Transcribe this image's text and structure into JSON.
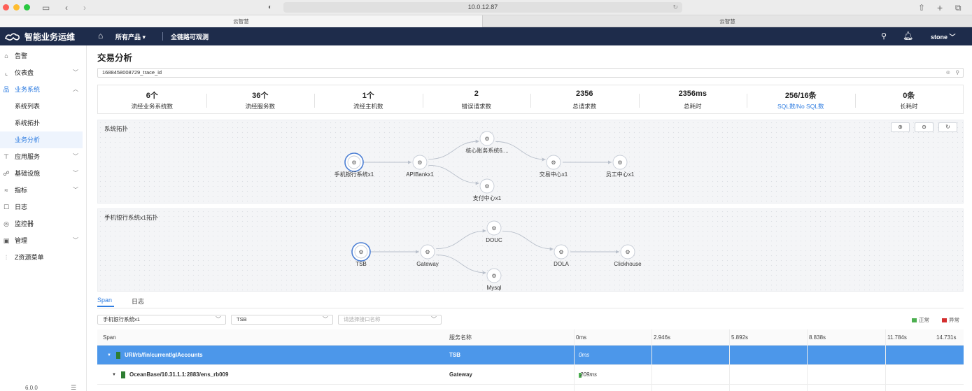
{
  "browser": {
    "url": "10.0.12.87",
    "tabs": [
      "云智慧",
      "云智慧"
    ]
  },
  "header": {
    "app_name": "智能业务运维",
    "products": "所有产品 ▾",
    "full_link": "全链路可观测",
    "user": "stone ﹀"
  },
  "sidebar": {
    "items": [
      {
        "icon": "alert-icon",
        "label": "告警"
      },
      {
        "icon": "dashboard-icon",
        "label": "仪表盘"
      },
      {
        "icon": "business-system-icon",
        "label": "业务系统"
      },
      {
        "label": "系统列表"
      },
      {
        "label": "系统拓扑"
      },
      {
        "label": "业务分析"
      },
      {
        "icon": "app-service-icon",
        "label": "应用服务"
      },
      {
        "icon": "infrastructure-icon",
        "label": "基础设施"
      },
      {
        "icon": "metrics-icon",
        "label": "指标"
      },
      {
        "icon": "log-icon",
        "label": "日志"
      },
      {
        "icon": "monitor-icon",
        "label": "监控器"
      },
      {
        "icon": "manage-icon",
        "label": "管理"
      },
      {
        "icon": "z-resource-icon",
        "label": "Z资源菜单"
      }
    ],
    "version": "6.0.0"
  },
  "page": {
    "title": "交易分析",
    "search_value": "1688458008729_trace_id"
  },
  "stats": [
    {
      "value": "6个",
      "label": "流经业务系统数"
    },
    {
      "value": "36个",
      "label": "流经服务数"
    },
    {
      "value": "1个",
      "label": "流经主机数"
    },
    {
      "value": "2",
      "label": "错误请求数"
    },
    {
      "value": "2356",
      "label": "总请求数"
    },
    {
      "value": "2356ms",
      "label": "总耗时"
    },
    {
      "value": "256/16条",
      "label": "SQL数/No SQL数"
    },
    {
      "value": "0条",
      "label": "长耗时"
    }
  ],
  "topology1": {
    "title": "系统拓扑",
    "nodes": [
      "手机银行系统x1",
      "APIBankx1",
      "核心账务系统6....",
      "支付中心x1",
      "交易中心x1",
      "员工中心x1"
    ]
  },
  "topology2": {
    "title": "手机银行系统x1拓扑",
    "nodes": [
      "TSB",
      "Gateway",
      "DOUC",
      "Mysql",
      "DOLA",
      "Clickhouse"
    ]
  },
  "span_tabs": [
    "Span",
    "日志"
  ],
  "filters": {
    "system": "手机银行系统x1",
    "service": "TSB",
    "interface_placeholder": "请选择接口名称"
  },
  "legend": [
    {
      "label": "正常",
      "color": "#4caf50"
    },
    {
      "label": "异常",
      "color": "#d32f2f"
    }
  ],
  "table": {
    "columns": [
      "Span",
      "服务名称"
    ],
    "ticks": [
      "0ms",
      "2.946s",
      "5.892s",
      "8.838s",
      "11.784s",
      "14.731s"
    ],
    "rows": [
      {
        "span": "URI/rb/fin/current/glAccounts",
        "service": "TSB",
        "time": "0ms"
      },
      {
        "span": "OceanBase/10.31.1.1:2883/ens_rb009",
        "service": "Gateway",
        "time": "209ms"
      }
    ]
  }
}
